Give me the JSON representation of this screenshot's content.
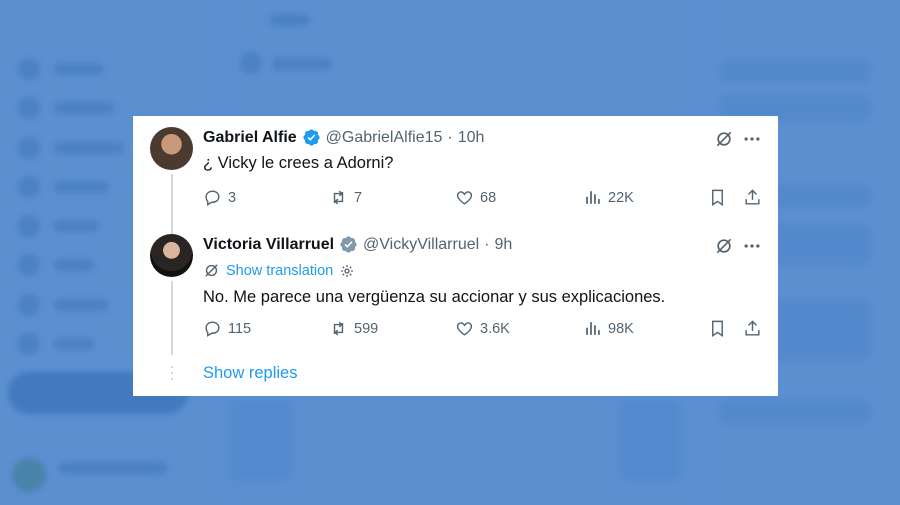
{
  "background": {
    "color": "#5a8fd0"
  },
  "tweets": [
    {
      "name": "Gabriel Alfie",
      "handle": "@GabrielAlfie15",
      "separator": "·",
      "time": "10h",
      "verified": "blue",
      "text": "¿ Vicky le crees a Adorni?",
      "replies": "3",
      "reposts": "7",
      "likes": "68",
      "views": "22K"
    },
    {
      "name": "Victoria Villarruel",
      "handle": "@VickyVillarruel",
      "separator": "·",
      "time": "9h",
      "verified": "gray",
      "translation_label": "Show translation",
      "text": "No. Me parece una vergüenza su accionar y sus explicaciones.",
      "replies": "115",
      "reposts": "599",
      "likes": "3.6K",
      "views": "98K"
    }
  ],
  "show_replies_label": "Show replies",
  "colors": {
    "accent": "#1d9bf0",
    "verified_blue": "#1d9bf0",
    "verified_gray": "#829aab",
    "muted": "#536471",
    "text": "#0f1419"
  },
  "icons": [
    "grok-icon",
    "more-icon",
    "reply-icon",
    "repost-icon",
    "like-icon",
    "views-icon",
    "bookmark-icon",
    "share-icon",
    "translate-icon",
    "gear-icon",
    "verified-badge-icon"
  ]
}
